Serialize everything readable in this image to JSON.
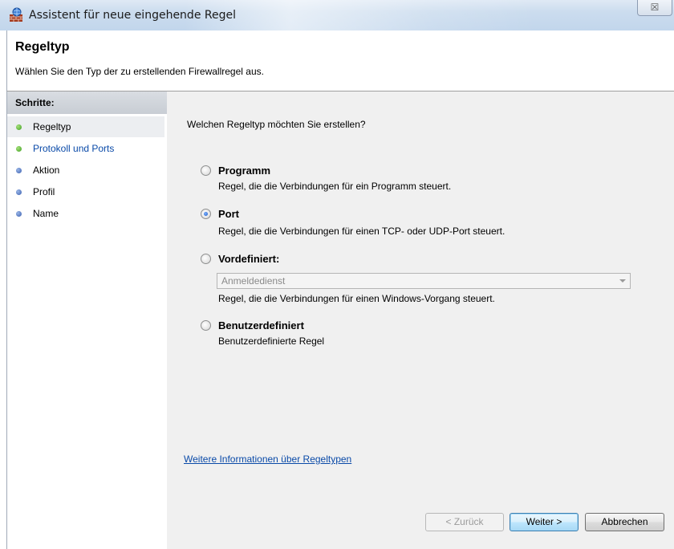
{
  "window": {
    "title": "Assistent für neue eingehende Regel",
    "close_symbol": "☒"
  },
  "header": {
    "title": "Regeltyp",
    "description": "Wählen Sie den Typ der zu erstellenden Firewallregel aus."
  },
  "steps": {
    "heading": "Schritte:",
    "items": [
      {
        "label": "Regeltyp",
        "status": "current"
      },
      {
        "label": "Protokoll und Ports",
        "status": "link"
      },
      {
        "label": "Aktion",
        "status": "pending"
      },
      {
        "label": "Profil",
        "status": "pending"
      },
      {
        "label": "Name",
        "status": "pending"
      }
    ]
  },
  "main": {
    "question": "Welchen Regeltyp möchten Sie erstellen?",
    "options": [
      {
        "label": "Programm",
        "description": "Regel, die die Verbindungen für ein Programm steuert.",
        "checked": false
      },
      {
        "label": "Port",
        "description": "Regel, die die Verbindungen für einen TCP- oder UDP-Port steuert.",
        "checked": true
      },
      {
        "label": "Vordefiniert:",
        "description": "Regel, die die Verbindungen für einen Windows-Vorgang steuert.",
        "checked": false
      },
      {
        "label": "Benutzerdefiniert",
        "description": "Benutzerdefinierte Regel",
        "checked": false
      }
    ],
    "predefined_select_value": "Anmeldedienst",
    "info_link": "Weitere Informationen über Regeltypen"
  },
  "buttons": {
    "back": "< Zurück",
    "next": "Weiter >",
    "cancel": "Abbrechen"
  },
  "colors": {
    "link": "#0a4aa8",
    "step_done_dot": "#3e9f22",
    "step_pending_dot": "#3a5fb0"
  },
  "icons": {
    "app": "firewall-wall-icon",
    "close": "close-icon"
  }
}
